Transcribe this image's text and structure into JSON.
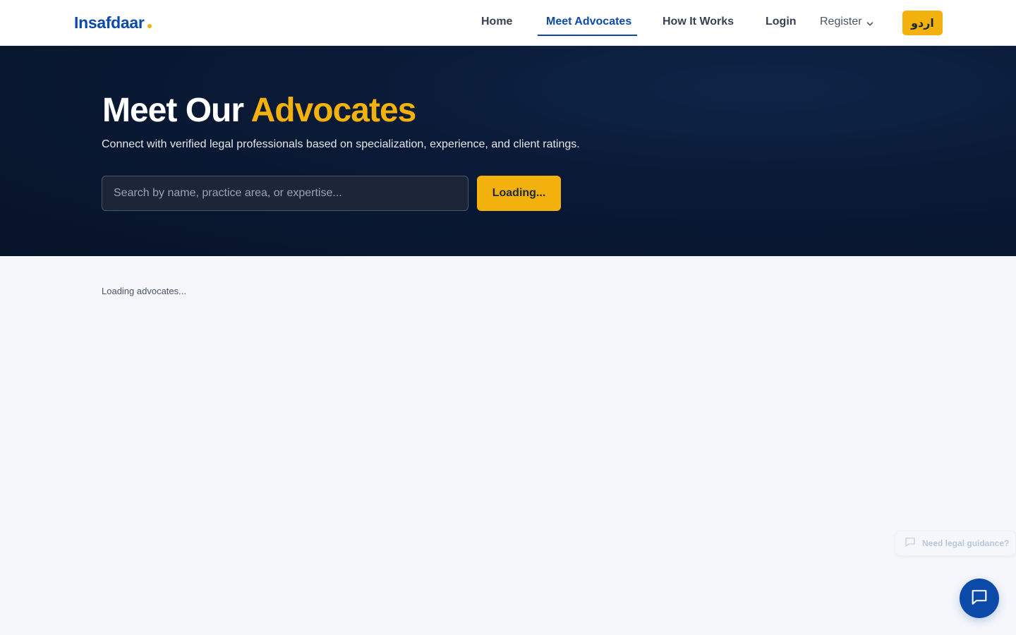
{
  "brand": {
    "name": "Insafdaar"
  },
  "nav": {
    "home": "Home",
    "meet_advocates": "Meet Advocates",
    "how_it_works": "How It Works",
    "login": "Login",
    "register": "Register",
    "language": "اردو"
  },
  "hero": {
    "title_part1": "Meet Our",
    "title_part2": "Advocates",
    "subtitle": "Connect with verified legal professionals based on specialization, experience, and client ratings.",
    "search_placeholder": "Search by name, practice area, or expertise...",
    "search_value": "",
    "search_button": "Loading..."
  },
  "main": {
    "status": "Loading advocates..."
  },
  "chat": {
    "prompt": "Need legal guidance?"
  },
  "colors": {
    "brand": "#0b4aa8",
    "accent": "#f2b10c",
    "hero_bg": "#0a1a36"
  },
  "icons": {
    "register_chevron": "chevron-down-icon",
    "guidance": "message-square-icon",
    "chat_fab": "message-square-icon"
  }
}
